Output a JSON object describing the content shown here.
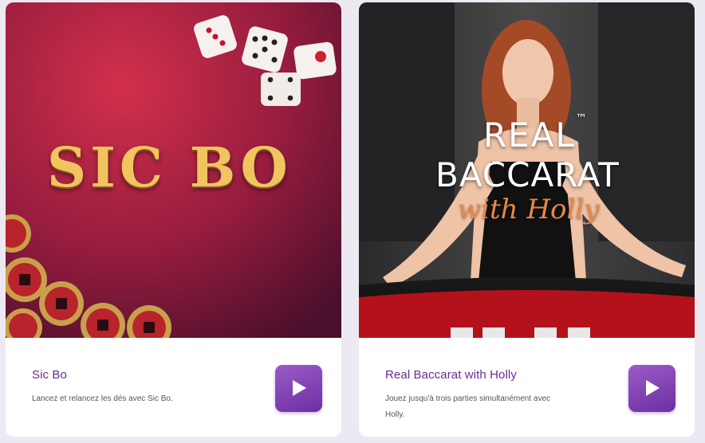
{
  "games": [
    {
      "art_text": "SIC BO",
      "title": "Sic Bo",
      "description": "Lancez et relancez les dés avec Sic Bo.",
      "play_icon": "play-icon"
    },
    {
      "art_line1": "REAL",
      "art_tm": "™",
      "art_line2": "BACCARAT",
      "art_line3": "with Holly",
      "title": "Real Baccarat with Holly",
      "description": "Jouez jusqu'à trois parties simultanément avec Holly.",
      "play_icon": "play-icon"
    }
  ],
  "colors": {
    "title": "#6a2c91",
    "play_button": "#8a47bf",
    "sicbo_bg": "#b01f3d",
    "script_orange": "#e9874a"
  }
}
